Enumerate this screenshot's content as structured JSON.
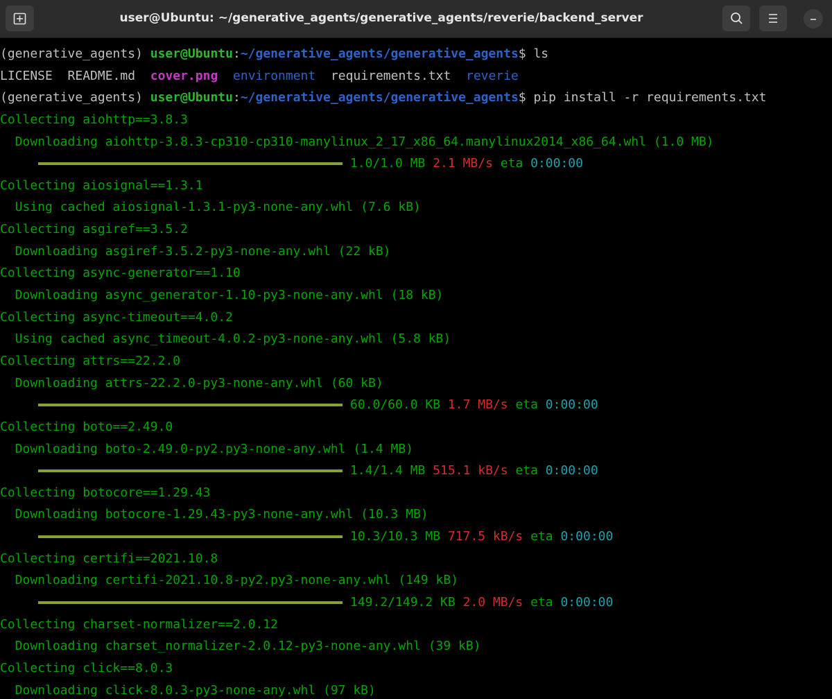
{
  "window": {
    "title": "user@Ubuntu: ~/generative_agents/generative_agents/reverie/backend_server",
    "icons": [
      "new-tab-icon",
      "search-icon",
      "menu-icon",
      "minimize-icon"
    ]
  },
  "colors": {
    "background": "#000000",
    "titlebar": "#2c2c2c",
    "text_green": "#00a600",
    "prompt_user": "#2fb62f",
    "prompt_path": "#2d63c8",
    "image_file": "#c538c5",
    "directory": "#2d63c8",
    "progress_bar": "#86a332",
    "speed": "#d22d2d",
    "eta_time": "#20a0a8"
  },
  "prompt": {
    "env": "(generative_agents) ",
    "user": "user@Ubuntu",
    "colon": ":",
    "path": "~/generative_agents/generative_agents",
    "dollar": "$ "
  },
  "commands": {
    "ls": "ls",
    "pip": "pip install -r requirements.txt"
  },
  "ls_output": {
    "license": "LICENSE",
    "readme": "README.md",
    "cover": "cover.png",
    "environment": "environment",
    "requirements": "requirements.txt",
    "reverie": "reverie"
  },
  "pip_lines": [
    {
      "collect": "Collecting aiohttp==3.8.3",
      "detail": "  Downloading aiohttp-3.8.3-cp310-cp310-manylinux_2_17_x86_64.manylinux2014_x86_64.whl (1.0 MB)",
      "progress": {
        "size": "1.0/1.0 MB",
        "speed": "2.1 MB/s",
        "eta": "0:00:00",
        "fraction": 1.0
      }
    },
    {
      "collect": "Collecting aiosignal==1.3.1",
      "detail": "  Using cached aiosignal-1.3.1-py3-none-any.whl (7.6 kB)"
    },
    {
      "collect": "Collecting asgiref==3.5.2",
      "detail": "  Downloading asgiref-3.5.2-py3-none-any.whl (22 kB)"
    },
    {
      "collect": "Collecting async-generator==1.10",
      "detail": "  Downloading async_generator-1.10-py3-none-any.whl (18 kB)"
    },
    {
      "collect": "Collecting async-timeout==4.0.2",
      "detail": "  Using cached async_timeout-4.0.2-py3-none-any.whl (5.8 kB)"
    },
    {
      "collect": "Collecting attrs==22.2.0",
      "detail": "  Downloading attrs-22.2.0-py3-none-any.whl (60 kB)",
      "progress": {
        "size": "60.0/60.0 KB",
        "speed": "1.7 MB/s",
        "eta": "0:00:00",
        "fraction": 1.0
      }
    },
    {
      "collect": "Collecting boto==2.49.0",
      "detail": "  Downloading boto-2.49.0-py2.py3-none-any.whl (1.4 MB)",
      "progress": {
        "size": "1.4/1.4 MB",
        "speed": "515.1 kB/s",
        "eta": "0:00:00",
        "fraction": 1.0
      }
    },
    {
      "collect": "Collecting botocore==1.29.43",
      "detail": "  Downloading botocore-1.29.43-py3-none-any.whl (10.3 MB)",
      "progress": {
        "size": "10.3/10.3 MB",
        "speed": "717.5 kB/s",
        "eta": "0:00:00",
        "fraction": 1.0
      }
    },
    {
      "collect": "Collecting certifi==2021.10.8",
      "detail": "  Downloading certifi-2021.10.8-py2.py3-none-any.whl (149 kB)",
      "progress": {
        "size": "149.2/149.2 KB",
        "speed": "2.0 MB/s",
        "eta": "0:00:00",
        "fraction": 1.0
      }
    },
    {
      "collect": "Collecting charset-normalizer==2.0.12",
      "detail": "  Downloading charset_normalizer-2.0.12-py3-none-any.whl (39 kB)"
    },
    {
      "collect": "Collecting click==8.0.3",
      "detail": "  Downloading click-8.0.3-py3-none-any.whl (97 kB)"
    }
  ],
  "eta_label": "eta"
}
